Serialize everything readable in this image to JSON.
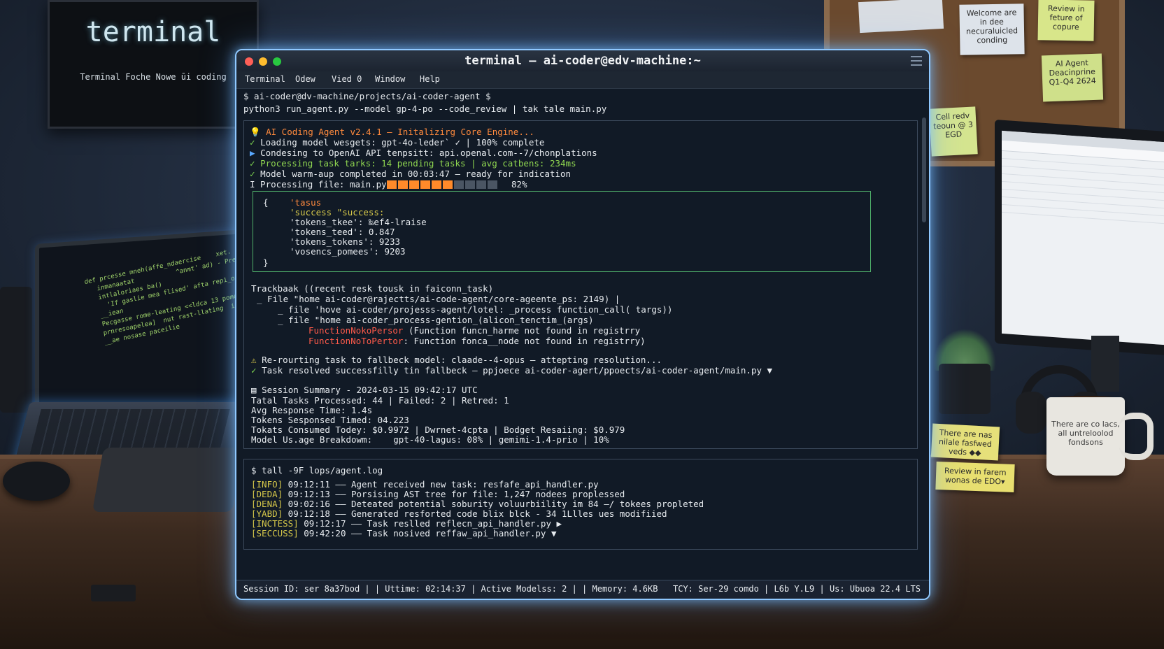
{
  "poster": {
    "title": "terminal",
    "subtitle": "Termīnal Foche Nowe ūi coding"
  },
  "notes": {
    "n1": "Welcome are in dee necuraluicled conding",
    "n2": "Review in feture of copure",
    "n3": "AI Agent Deacinprine Q1-Q4 2624",
    "n4": "Cell redv teoun @ 3 EGD",
    "n5": "There are nas nilale fasfwed veds ◆◆",
    "n6": "Review in farem wonas de EDO▾",
    "mug": "There are co lacs, all untreloolod fondsons"
  },
  "window": {
    "title": "terminal — ai-coder@edv-machine:~",
    "menu": [
      "Terminal",
      "Odew",
      "Vied 0",
      "Window",
      "Help"
    ]
  },
  "command": {
    "prompt": "$ ai-coder@dv-machine/projects/ai-coder-agent $",
    "cmd": "python3 run_agent.py --model gp-4-po --code_review | tak tale main.py"
  },
  "init": {
    "header": "AI Coding Agent v2.4.1 — Initalizirg Core Engine...",
    "lines": [
      {
        "icon": "✓",
        "text": "Loading model wesgets: gpt-4o-leder` ✓ | 100% complete"
      },
      {
        "icon": "▶",
        "text": "Condesing to OpenAI API tenpsitt: api.openal.com--7/chonplations"
      },
      {
        "icon": "✓",
        "text": "Processing task tarks: 14 pending tasks | avg catbens: 234ms"
      },
      {
        "icon": "✓",
        "text": "Model warm-aup completed in 00:03:47 — ready for indication"
      }
    ],
    "processing_label": "I Processing file: main.py",
    "progress_percent_label": "82%",
    "progress": 0.82
  },
  "json": {
    "open": "{",
    "close": "}",
    "lines": [
      "'tasus",
      "'success \"success:",
      "'tokens_tkee': ‰ef4-lraise",
      "'tokens_teed': 0.847",
      "'tokens_tokens': 9233",
      "'vosencs_pomees': 9203"
    ]
  },
  "traceback": {
    "header": "Trackbaak ((recent resk tousk in faiconn_task)",
    "lines": [
      "_ File \"home ai-coder@rajectts/ai-code-agent/core-ageente_ps: 2149) |",
      "_ file 'hove ai-coder/projesss-agent/lotel: _process function_call( targs))",
      "_ file \"home ai-coder_process-gention_(alicon_tenctim_(args)"
    ],
    "errors": [
      {
        "name": "FunctionNokoPersor",
        "msg": " (Function funcn_harme not found in registrry"
      },
      {
        "name": "FunctionNoToPertor",
        "msg": ": Function fonca__node not found in registrry)"
      }
    ]
  },
  "fallback": {
    "warn": "Re-rourting task to fallbeck model: claade--4-opus — attepting resolution...",
    "ok": "Task resolved successfilly tin fallbeck — ppjoece ai-coder-agert/ppoects/ai-coder-agent/main.py ▼"
  },
  "summary": {
    "title": "Session Summary - 2024-03-15 09:42:17 UTC",
    "lines": [
      "Tatal Tasks Processed: 44 | Failed: 2 | Retred: 1",
      "Avg Response Time: 1.4s",
      "Tokens Sesponsed Timed: 04.223",
      "Tokats Consumed Todey: $0.9972 | Dwrnet-4cpta | Bodget Resaiing: $0.979",
      "Model Us.age Breakdowm:    gpt-40-lagus: 08% | gemimi-1.4-prio | 10%"
    ]
  },
  "log": {
    "cmd": "$ tall -9F lops/agent.log",
    "entries": [
      {
        "tag": "[INFO]",
        "text": " 09:12:11 —— Agent received new task: resfafe_api_handler.py"
      },
      {
        "tag": "[DEDA]",
        "text": " 09:12:13 —— Porsising AST tree for file: 1,247 nodees proplessed"
      },
      {
        "tag": "[DENA]",
        "text": " 09:02:16 —— Deteated potential soburity voluurbiility im 84 —/ tokees propleted"
      },
      {
        "tag": "[YABD]",
        "text": " 09:12:18 —— Generated resforted code blix blck - 34 1Llles ues modifiied"
      },
      {
        "tag": "[INCTESS]",
        "text": " 09:12:17 —— Task reslled reflecn_api_handler.py ▶"
      },
      {
        "tag": "[SECCUSS]",
        "text": " 09:42:20 —— Task nosived reffaw_api_handler.py ▼"
      }
    ]
  },
  "status": {
    "left": "Session ID: ser 8a37bod | | Uttime: 02:14:37 | Active Modelss: 2 | | Memory: 4.6KB",
    "right": "TCY: Ser-29 comdo | L6b Y.L9 | Us: Ubuoa 22.4 LTS"
  },
  "laptop_code": "def prcesse mneh(affe_ndaercise    xet. av)\n   inmanaatat           ^anmt' ad) - Pressn\n   intlaloriaes ba()\n     'If gaslie mea flised' afta repi_on meil)\n   __iean\n   Pecgasse rome-leating <<ldca 13 pome)\n   prnresoapelea]  nut rast-llating  in Af ana'\n   __ae nosase paceilie"
}
